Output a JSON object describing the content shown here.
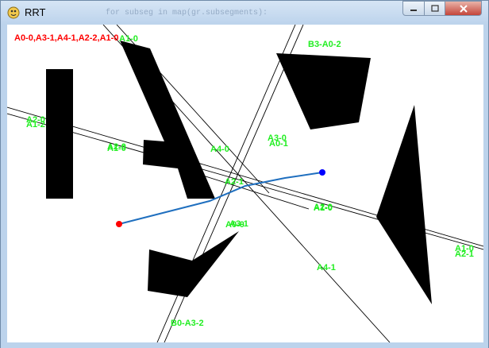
{
  "window": {
    "title": "RRT",
    "background_code_text": "for subseg in map(gr.subsegments):",
    "controls": {
      "minimize": "minimize",
      "maximize": "maximize",
      "close": "close"
    },
    "colors": {
      "canvas": "#ffffff",
      "obstacle": "#000000",
      "path": "#1f6fbf",
      "start": "#ff0000",
      "goal": "#0000ff",
      "labels": "#22ee22",
      "plan": "#ff0000"
    }
  },
  "canvas": {
    "plan_text": "A0-0,A3-1,A4-1,A2-2,A1-0",
    "labels": [
      "A1-0",
      "B3-A0-2",
      "A2-0",
      "A1-2",
      "A1-0",
      "A2-0",
      "A4-0",
      "A3-0",
      "A0-1",
      "A2-1",
      "A1-0",
      "A2-0",
      "A3-1",
      "A0-0",
      "A4-1",
      "A1-0",
      "A2-1",
      "B0-A3-2"
    ]
  }
}
